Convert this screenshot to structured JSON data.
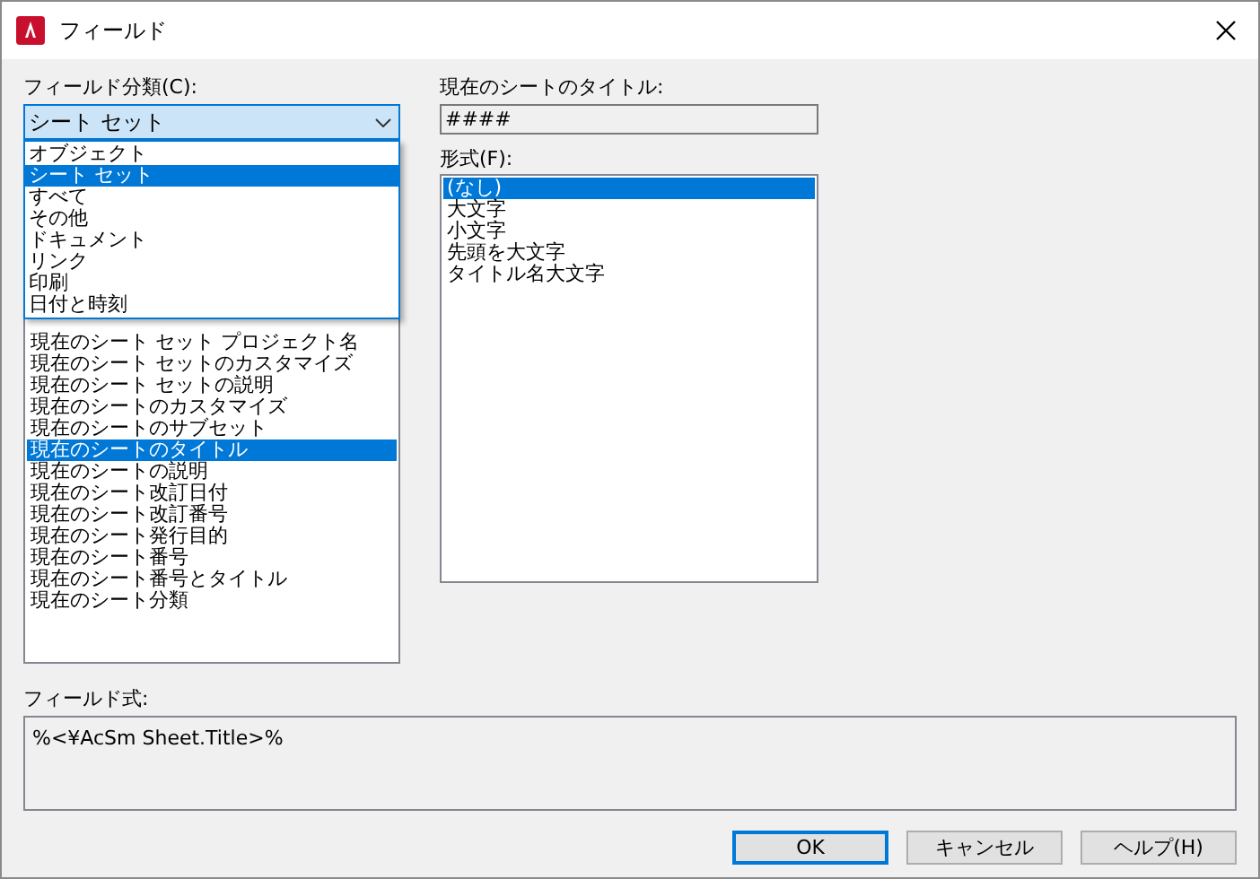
{
  "window": {
    "title": "フィールド"
  },
  "category": {
    "label": "フィールド分類(C):",
    "value": "シート セット",
    "expanded": true,
    "options": [
      {
        "label": "オブジェクト",
        "selected": false
      },
      {
        "label": "シート セット",
        "selected": true
      },
      {
        "label": "すべて",
        "selected": false
      },
      {
        "label": "その他",
        "selected": false
      },
      {
        "label": "ドキュメント",
        "selected": false
      },
      {
        "label": "リンク",
        "selected": false
      },
      {
        "label": "印刷",
        "selected": false
      },
      {
        "label": "日付と時刻",
        "selected": false
      }
    ]
  },
  "field_names": [
    {
      "label": "現在のシート セット プロジェクト名",
      "selected": false
    },
    {
      "label": "現在のシート セットのカスタマイズ",
      "selected": false
    },
    {
      "label": "現在のシート セットの説明",
      "selected": false
    },
    {
      "label": "現在のシートのカスタマイズ",
      "selected": false
    },
    {
      "label": "現在のシートのサブセット",
      "selected": false
    },
    {
      "label": "現在のシートのタイトル",
      "selected": true
    },
    {
      "label": "現在のシートの説明",
      "selected": false
    },
    {
      "label": "現在のシート改訂日付",
      "selected": false
    },
    {
      "label": "現在のシート改訂番号",
      "selected": false
    },
    {
      "label": "現在のシート発行目的",
      "selected": false
    },
    {
      "label": "現在のシート番号",
      "selected": false
    },
    {
      "label": "現在のシート番号とタイトル",
      "selected": false
    },
    {
      "label": "現在のシート分類",
      "selected": false
    }
  ],
  "value_field": {
    "label": "現在のシートのタイトル:",
    "value": "####"
  },
  "format": {
    "label": "形式(F):",
    "items": [
      {
        "label": "(なし)",
        "selected": true
      },
      {
        "label": "大文字",
        "selected": false
      },
      {
        "label": "小文字",
        "selected": false
      },
      {
        "label": "先頭を大文字",
        "selected": false
      },
      {
        "label": "タイトル名大文字",
        "selected": false
      }
    ]
  },
  "expression": {
    "label": "フィールド式:",
    "value": "%<¥AcSm Sheet.Title>%"
  },
  "buttons": [
    {
      "label": "OK",
      "default": true
    },
    {
      "label": "キャンセル",
      "default": false
    },
    {
      "label": "ヘルプ(H)",
      "default": false
    }
  ]
}
